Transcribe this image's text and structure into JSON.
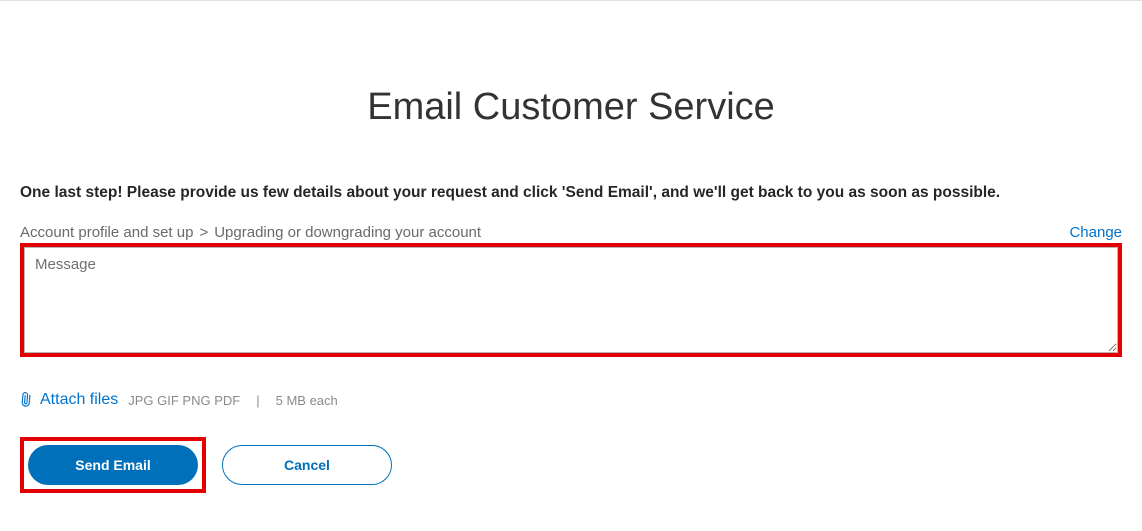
{
  "header": {
    "title": "Email Customer Service"
  },
  "instruction": "One last step! Please provide us few details about your request and click 'Send Email', and we'll get back to you as soon as possible.",
  "breadcrumb": {
    "level1": "Account profile and set up",
    "separator": ">",
    "level2": "Upgrading or downgrading your account",
    "change_label": "Change"
  },
  "message": {
    "placeholder": "Message",
    "value": ""
  },
  "attach": {
    "label": "Attach files",
    "formats": "JPG GIF PNG PDF",
    "separator": "|",
    "size_limit": "5 MB each"
  },
  "buttons": {
    "send": "Send Email",
    "cancel": "Cancel"
  }
}
